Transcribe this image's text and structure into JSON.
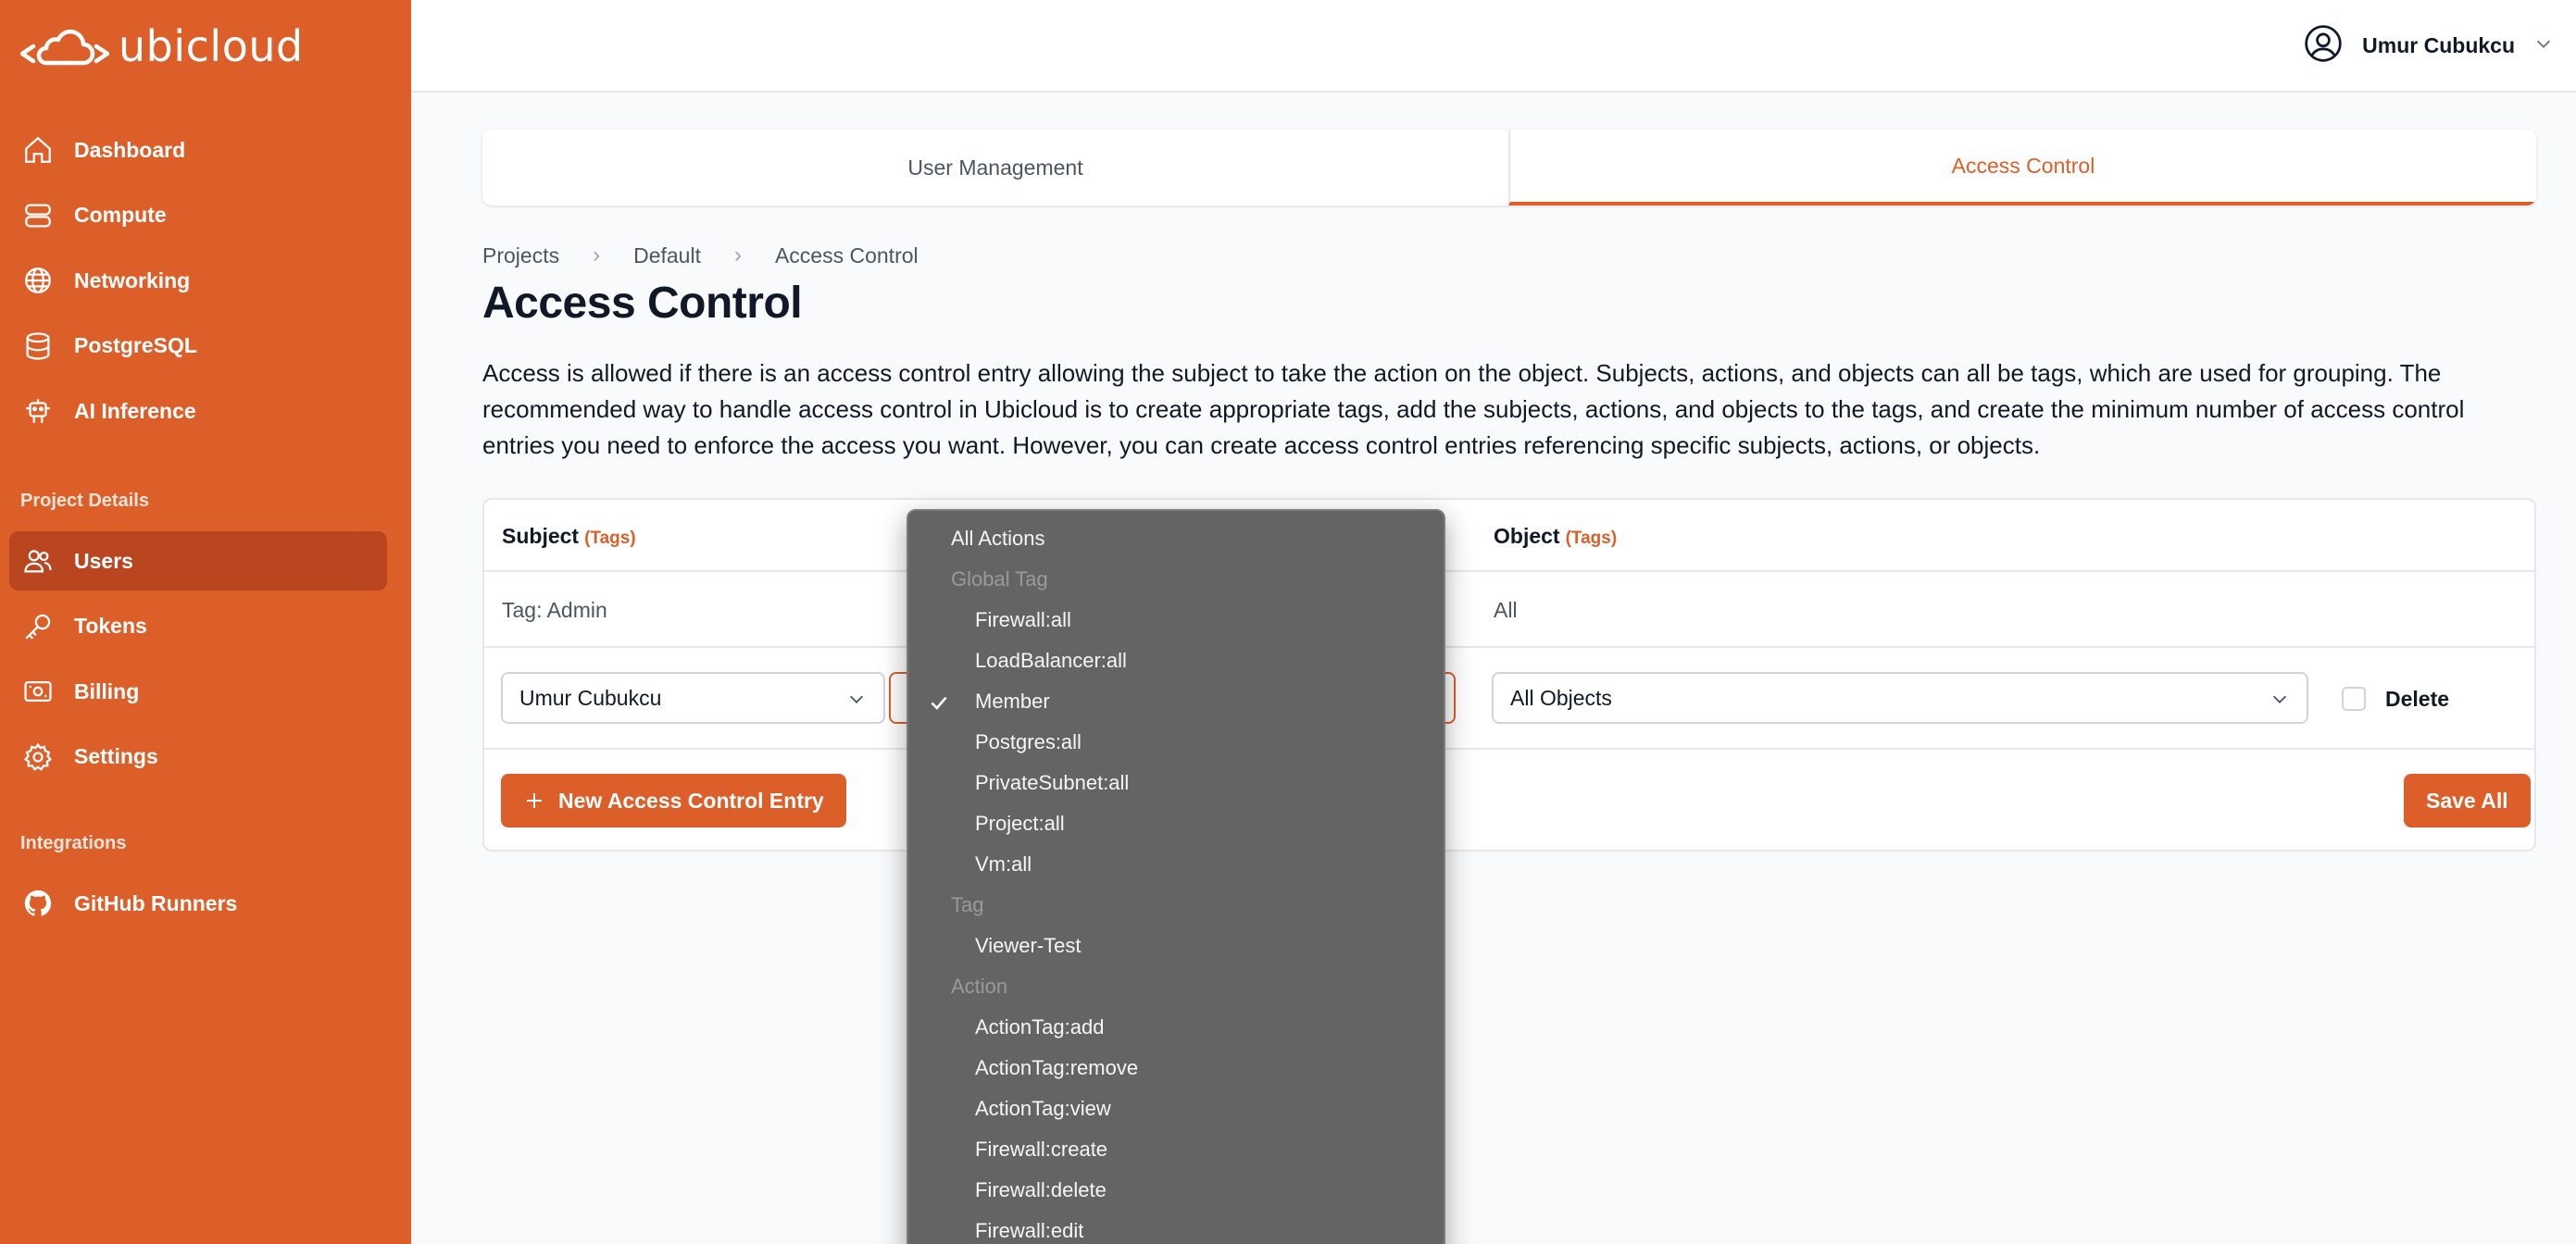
{
  "app": {
    "brand": "ubicloud"
  },
  "sidebar": {
    "items": [
      {
        "label": "Dashboard",
        "icon": "home-icon"
      },
      {
        "label": "Compute",
        "icon": "server-icon"
      },
      {
        "label": "Networking",
        "icon": "globe-icon"
      },
      {
        "label": "PostgreSQL",
        "icon": "database-icon"
      },
      {
        "label": "AI Inference",
        "icon": "robot-icon"
      }
    ],
    "project_section_label": "Project Details",
    "project_items": [
      {
        "label": "Users",
        "icon": "users-icon",
        "active": true
      },
      {
        "label": "Tokens",
        "icon": "key-icon"
      },
      {
        "label": "Billing",
        "icon": "billing-icon"
      },
      {
        "label": "Settings",
        "icon": "gear-icon"
      }
    ],
    "integrations_label": "Integrations",
    "integration_items": [
      {
        "label": "GitHub Runners",
        "icon": "github-icon"
      }
    ]
  },
  "header": {
    "user_name": "Umur Cubukcu"
  },
  "tabs": [
    {
      "label": "User Management"
    },
    {
      "label": "Access Control",
      "active": true
    }
  ],
  "breadcrumb": [
    "Projects",
    "Default",
    "Access Control"
  ],
  "page": {
    "title": "Access Control",
    "description": "Access is allowed if there is an access control entry allowing the subject to take the action on the object. Subjects, actions, and objects can all be tags, which are used for grouping. The recommended way to handle access control in Ubicloud is to create appropriate tags, add the subjects, actions, and objects to the tags, and create the minimum number of access control entries you need to enforce the access you want. However, you can create access control entries referencing specific subjects, actions, or objects."
  },
  "table": {
    "subject_header": "Subject",
    "object_header": "Object",
    "tags_link": "(Tags)",
    "static_row": {
      "subject": "Tag: Admin",
      "object": "All"
    },
    "edit_row": {
      "subject_value": "Umur Cubukcu",
      "object_value": "All Objects",
      "delete_label": "Delete"
    },
    "new_entry_button": "New Access Control Entry",
    "save_all_button": "Save All"
  },
  "dropdown": {
    "items": [
      {
        "label": "All Actions",
        "type": "option"
      },
      {
        "label": "Global Tag",
        "type": "group"
      },
      {
        "label": "Firewall:all",
        "type": "option"
      },
      {
        "label": "LoadBalancer:all",
        "type": "option"
      },
      {
        "label": "Member",
        "type": "option",
        "selected": true
      },
      {
        "label": "Postgres:all",
        "type": "option"
      },
      {
        "label": "PrivateSubnet:all",
        "type": "option"
      },
      {
        "label": "Project:all",
        "type": "option"
      },
      {
        "label": "Vm:all",
        "type": "option"
      },
      {
        "label": "Tag",
        "type": "group"
      },
      {
        "label": "Viewer-Test",
        "type": "option"
      },
      {
        "label": "Action",
        "type": "group"
      },
      {
        "label": "ActionTag:add",
        "type": "option"
      },
      {
        "label": "ActionTag:remove",
        "type": "option"
      },
      {
        "label": "ActionTag:view",
        "type": "option"
      },
      {
        "label": "Firewall:create",
        "type": "option"
      },
      {
        "label": "Firewall:delete",
        "type": "option"
      },
      {
        "label": "Firewall:edit",
        "type": "option"
      }
    ]
  },
  "colors": {
    "accent": "#dc5f2a",
    "accent_dark": "#b9461f",
    "dropdown_bg": "#646464"
  }
}
